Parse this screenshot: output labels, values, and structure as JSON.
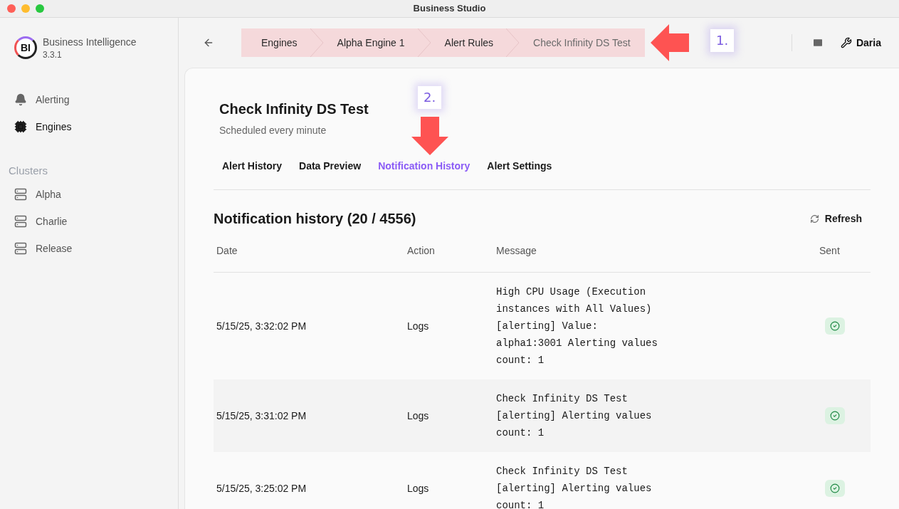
{
  "window": {
    "title": "Business Studio"
  },
  "app": {
    "name": "Business Intelligence",
    "version": "3.3.1",
    "logo": "BI"
  },
  "nav": [
    {
      "label": "Alerting",
      "selected": false
    },
    {
      "label": "Engines",
      "selected": true
    }
  ],
  "clusters": {
    "heading": "Clusters",
    "items": [
      {
        "label": "Alpha"
      },
      {
        "label": "Charlie"
      },
      {
        "label": "Release"
      }
    ]
  },
  "breadcrumbs": [
    {
      "label": "Engines",
      "current": false
    },
    {
      "label": "Alpha Engine 1",
      "current": false
    },
    {
      "label": "Alert Rules",
      "current": false
    },
    {
      "label": "Check Infinity DS Test",
      "current": true
    }
  ],
  "user": {
    "name": "Daria"
  },
  "page": {
    "title": "Check Infinity DS Test",
    "subtitle": "Scheduled every minute"
  },
  "tabs": [
    {
      "label": "Alert History",
      "selected": false
    },
    {
      "label": "Data Preview",
      "selected": false
    },
    {
      "label": "Notification History",
      "selected": true
    },
    {
      "label": "Alert Settings",
      "selected": false
    }
  ],
  "section": {
    "title": "Notification history (20 / 4556)",
    "refresh": "Refresh"
  },
  "table": {
    "columns": [
      "Date",
      "Action",
      "Message",
      "Sent"
    ],
    "rows": [
      {
        "date": "5/15/25, 3:32:02 PM",
        "action": "Logs",
        "message": "High CPU Usage (Execution\ninstances with All Values)\n[alerting] Value:\nalpha1:3001 Alerting values\ncount: 1",
        "sent": true
      },
      {
        "date": "5/15/25, 3:31:02 PM",
        "action": "Logs",
        "message": "Check Infinity DS Test\n[alerting] Alerting values\ncount: 1",
        "sent": true
      },
      {
        "date": "5/15/25, 3:25:02 PM",
        "action": "Logs",
        "message": "Check Infinity DS Test\n[alerting] Alerting values\ncount: 1",
        "sent": true
      }
    ]
  },
  "annotations": [
    {
      "label": "1."
    },
    {
      "label": "2."
    }
  ]
}
